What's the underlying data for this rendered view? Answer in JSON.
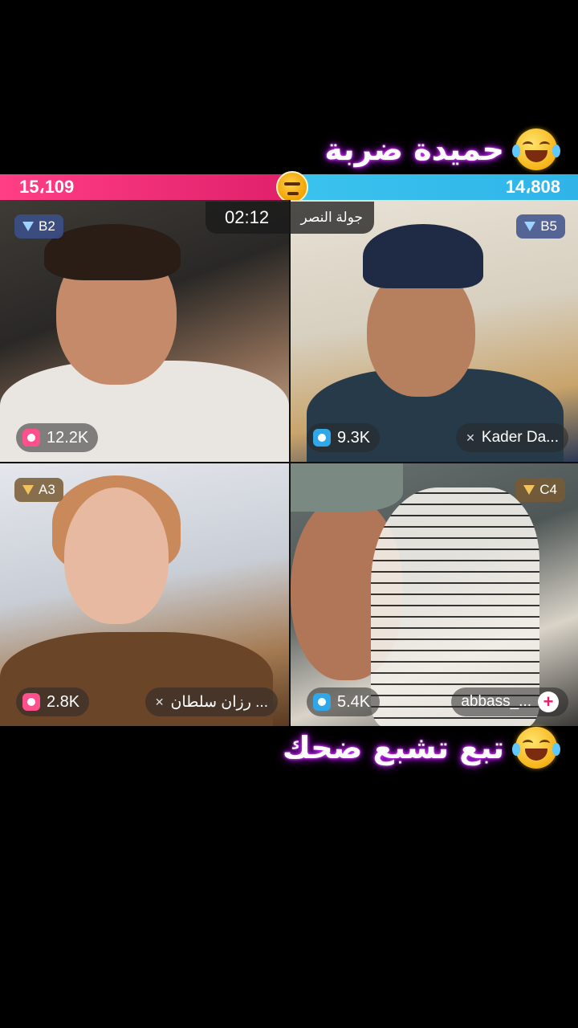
{
  "captions": {
    "top": "حميدة ضربة",
    "bottom": "تبع تشبع ضحك"
  },
  "scores": {
    "left": "15،109",
    "right": "14،808"
  },
  "timer": {
    "time": "02:12",
    "label": "جولة النصر"
  },
  "tiles": [
    {
      "rank": "B2",
      "likes": "12.2K",
      "name": ""
    },
    {
      "rank": "B5",
      "likes": "9.3K",
      "name": "Kader Da..."
    },
    {
      "rank": "A3",
      "likes": "2.8K",
      "name": "رزان سلطان ..."
    },
    {
      "rank": "C4",
      "likes": "5.4K",
      "name": "abbass_..."
    }
  ],
  "colors": {
    "score_left": "#ff3e86",
    "score_right": "#3bc3ee",
    "caption_glow": "#b300ff"
  },
  "icons": {
    "caption_emoji": "laughing-tears-icon",
    "vs": "angry-face-icon",
    "rank": "diamond-icon",
    "likes": "gift-icon",
    "add": "plus-icon"
  }
}
